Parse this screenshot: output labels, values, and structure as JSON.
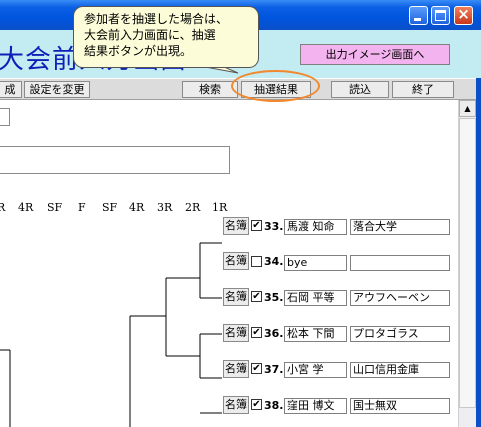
{
  "window": {
    "title": "大会前入力画面",
    "output_button": "出力イメージ画面へ"
  },
  "toolbar": {
    "left_fragment": "成",
    "change_settings": "設定を変更",
    "search": "検索",
    "lottery_result": "抽選結果",
    "load": "読込",
    "exit": "終了"
  },
  "callout": {
    "lines": [
      "参加者を抽選した場合は、",
      "大会前入力画面に、抽選",
      "結果ボタンが出現。"
    ]
  },
  "rounds": [
    "R",
    "4R",
    "SF",
    "F",
    "SF",
    "4R",
    "3R",
    "2R",
    "1R"
  ],
  "entries": [
    {
      "button": "名簿",
      "checked": "✔",
      "num": "33.",
      "name": "馬渡 知命",
      "affiliation": "落合大学"
    },
    {
      "button": "名簿",
      "checked": "",
      "num": "34.",
      "name": "bye",
      "affiliation": ""
    },
    {
      "button": "名簿",
      "checked": "✔",
      "num": "35.",
      "name": "石岡 平等",
      "affiliation": "アウフヘーベン"
    },
    {
      "button": "名簿",
      "checked": "✔",
      "num": "36.",
      "name": "松本 下間",
      "affiliation": "プロタゴラス"
    },
    {
      "button": "名簿",
      "checked": "✔",
      "num": "37.",
      "name": "小宮 学",
      "affiliation": "山口信用金庫"
    },
    {
      "button": "名簿",
      "checked": "✔",
      "num": "38.",
      "name": "窪田 博文",
      "affiliation": "国士無双"
    }
  ],
  "colors": {
    "title_bar": "#0055de",
    "header_band": "#c2ecf2",
    "title_text": "#0e1fb8",
    "output_button": "#f3b3ee",
    "callout_fill": "#fcfcd8",
    "highlight": "#f2882e"
  },
  "icons": {
    "minimize": "minimize-icon",
    "maximize": "maximize-icon",
    "close": "close-icon",
    "scroll_up": "scroll-up-arrow-icon"
  }
}
